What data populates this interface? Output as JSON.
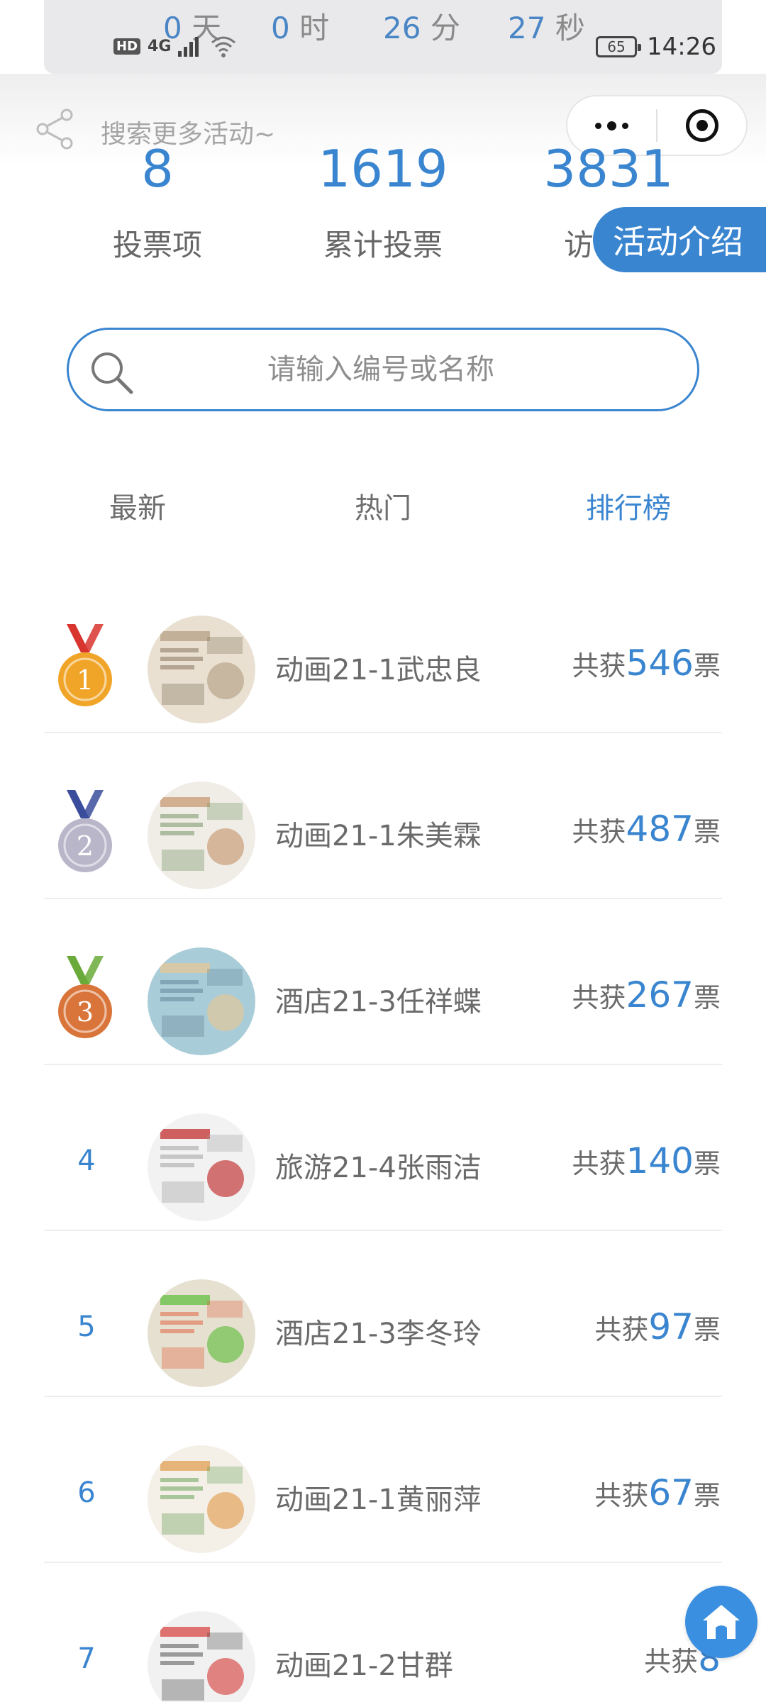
{
  "countdown": {
    "days": "0",
    "days_unit": "天",
    "hours": "0",
    "hours_unit": "时",
    "minutes": "26",
    "minutes_unit": "分",
    "seconds": "27",
    "seconds_unit": "秒"
  },
  "status_bar": {
    "hd": "HD",
    "signal": "4G",
    "battery": "65",
    "time": "14:26"
  },
  "nav": {
    "search_hint": "搜索更多活动~"
  },
  "stats": [
    {
      "value": "8",
      "label": "投票项"
    },
    {
      "value": "1619",
      "label": "累计投票"
    },
    {
      "value": "3831",
      "label": "访"
    }
  ],
  "intro_button": "活动介绍",
  "search": {
    "placeholder": "请输入编号或名称"
  },
  "tabs": [
    {
      "label": "最新",
      "active": false
    },
    {
      "label": "热门",
      "active": false
    },
    {
      "label": "排行榜",
      "active": true
    }
  ],
  "ranking": [
    {
      "rank": "1",
      "name": "动画21-1武忠良",
      "prefix": "共获",
      "votes": "546",
      "suffix": "票"
    },
    {
      "rank": "2",
      "name": "动画21-1朱美霖",
      "prefix": "共获",
      "votes": "487",
      "suffix": "票"
    },
    {
      "rank": "3",
      "name": "酒店21-3任祥蝶",
      "prefix": "共获",
      "votes": "267",
      "suffix": "票"
    },
    {
      "rank": "4",
      "name": "旅游21-4张雨洁",
      "prefix": "共获",
      "votes": "140",
      "suffix": "票"
    },
    {
      "rank": "5",
      "name": "酒店21-3李冬玲",
      "prefix": "共获",
      "votes": "97",
      "suffix": "票"
    },
    {
      "rank": "6",
      "name": "动画21-1黄丽萍",
      "prefix": "共获",
      "votes": "67",
      "suffix": "票"
    },
    {
      "rank": "7",
      "name": "动画21-2甘群",
      "prefix": "共获",
      "votes": "8",
      "suffix": ""
    }
  ],
  "colors": {
    "accent": "#3a85d0",
    "gold": "#f0a529",
    "silver": "#b9b6c9",
    "bronze": "#d9753a"
  }
}
